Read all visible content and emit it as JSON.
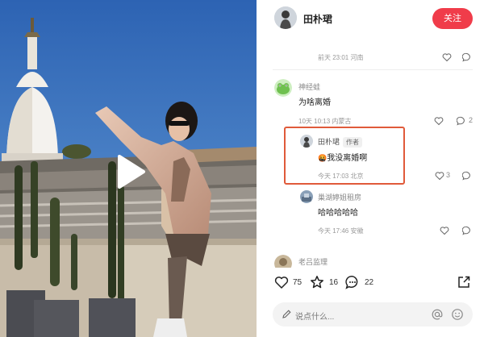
{
  "video": {
    "play_icon": "play-icon"
  },
  "header": {
    "author_name": "田朴珺",
    "follow_label": "关注"
  },
  "post_meta": {
    "time_location": "前天 23:01 河南"
  },
  "comments": [
    {
      "user": "神经蛙",
      "text": "为啥离婚",
      "time_location": "10天 10:13 内蒙古",
      "likes": "",
      "replies": "2"
    },
    {
      "user": "田朴珺",
      "tag": "作者",
      "emoji": "🤬",
      "text": "我没离婚啊",
      "time_location": "今天 17:03 北京",
      "likes": "3",
      "replies": ""
    },
    {
      "user": "巢湖婷姐租房",
      "text": "哈哈哈哈哈",
      "time_location": "今天 17:46 安徽",
      "likes": "",
      "replies": ""
    },
    {
      "user": "老吕监理",
      "text": ""
    }
  ],
  "stats": {
    "likes": "75",
    "favorites": "16",
    "comments": "22"
  },
  "input": {
    "placeholder": "说点什么..."
  },
  "colors": {
    "accent": "#f03c4a",
    "highlight_border": "#e05a3a"
  }
}
